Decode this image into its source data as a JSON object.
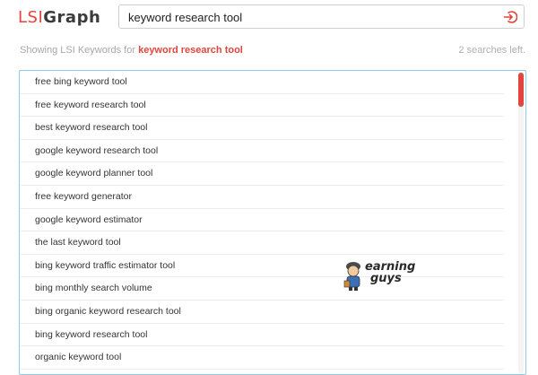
{
  "logo": {
    "part1": "LSI",
    "part2": "Graph"
  },
  "search": {
    "value": "keyword research tool"
  },
  "info": {
    "prefix": "Showing LSI Keywords for ",
    "keyword": "keyword research tool",
    "searches_left": "2 searches left."
  },
  "results": [
    "free bing keyword tool",
    "free keyword research tool",
    "best keyword research tool",
    "google keyword research tool",
    "google keyword planner tool",
    "free keyword generator",
    "google keyword estimator",
    "the last keyword tool",
    "bing keyword traffic estimator tool",
    "bing monthly search volume",
    "bing organic keyword research tool",
    "bing keyword research tool",
    "organic keyword tool"
  ],
  "watermark": {
    "line1": "earning",
    "line2": "guys"
  },
  "colors": {
    "accent": "#e2453d",
    "border": "#8fcbea"
  }
}
